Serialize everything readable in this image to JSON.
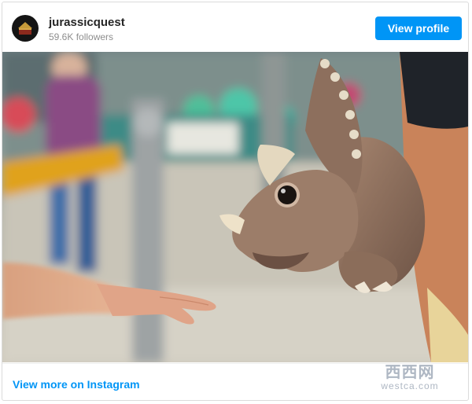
{
  "header": {
    "username": "jurassicquest",
    "followers": "59.6K followers",
    "view_profile_label": "View profile"
  },
  "post": {
    "image_icon": "photo-dinosaur-puppet"
  },
  "footer": {
    "view_more_label": "View more on Instagram"
  },
  "watermark": {
    "line1": "西西网",
    "line2": "westca.com"
  },
  "colors": {
    "accent": "#0095f6",
    "username": "#262626",
    "secondary_text": "#8e8e8e",
    "border": "#dbdbdb"
  }
}
